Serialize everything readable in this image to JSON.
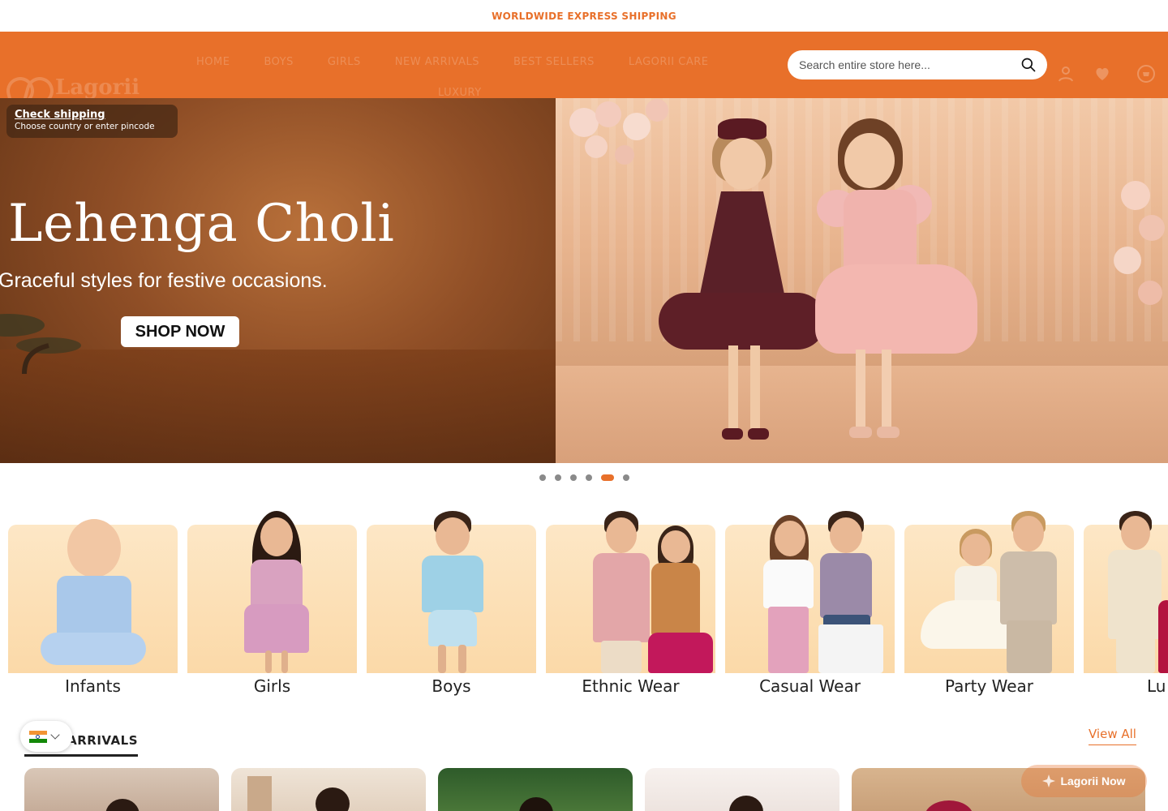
{
  "announcement": {
    "text": "WORLDWIDE EXPRESS SHIPPING"
  },
  "header": {
    "logo_text": "Lagorii",
    "nav": [
      "HOME",
      "BOYS",
      "GIRLS",
      "NEW ARRIVALS",
      "BEST SELLERS",
      "LAGORII CARE"
    ],
    "nav_second_row": "LUXURY",
    "search": {
      "placeholder": "Search entire store here..."
    },
    "icons": [
      "user-icon",
      "heart-icon",
      "cart-icon"
    ],
    "accent_color": "#e8702a"
  },
  "hero": {
    "title": "Lehenga Choli",
    "subtitle": "Graceful styles for festive occasions.",
    "cta": "SHOP NOW",
    "shipping": {
      "title": "Check shipping",
      "subtitle": "Choose country or enter pincode"
    },
    "slides_count": 6,
    "active_slide": 5
  },
  "categories": [
    {
      "label": "Infants"
    },
    {
      "label": "Girls"
    },
    {
      "label": "Boys"
    },
    {
      "label": "Ethnic Wear"
    },
    {
      "label": "Casual Wear"
    },
    {
      "label": "Party Wear"
    },
    {
      "label": "Lu"
    }
  ],
  "new_arrivals": {
    "title": "NEW ARRIVALS",
    "visible_title": "ARRIVALS",
    "view_all": "View All"
  },
  "chat_widget": {
    "label": "Lagorii Now"
  },
  "country_selector": {
    "flag": "india-flag-icon"
  }
}
